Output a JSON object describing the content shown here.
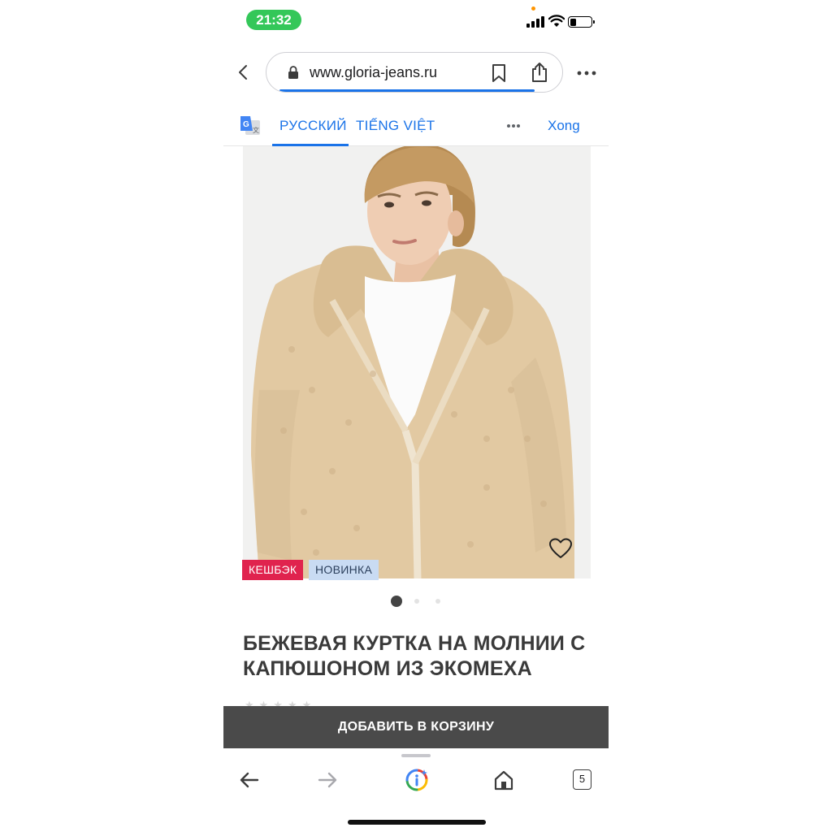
{
  "status_bar": {
    "time": "21:32",
    "tab_count": "5"
  },
  "browser": {
    "url": "www.gloria-jeans.ru"
  },
  "translate_bar": {
    "source_lang": "РУССКИЙ",
    "target_lang": "TIẾNG VIỆT",
    "done_label": "Xong"
  },
  "product": {
    "badges": [
      "КЕШБЭК",
      "НОВИНКА"
    ],
    "title": "БЕЖЕВАЯ КУРТКА НА МОЛНИИ С КАПЮШОНОМ ИЗ ЭКОМЕХА",
    "rating_stars": "★★★★★",
    "image_count": 3,
    "current_image": 1,
    "add_to_cart_label": "ДОБАВИТЬ В КОРЗИНУ"
  },
  "colors": {
    "accent": "#1a73e8",
    "cashback_badge": "#e0234e",
    "new_badge": "#c9dbf3",
    "cart_button": "#4a4a4a",
    "status_time": "#34c759"
  },
  "icons": [
    "back-chevron-icon",
    "lock-icon",
    "bookmark-icon",
    "share-icon",
    "more-icon",
    "google-translate-icon",
    "heart-icon",
    "back-arrow-icon",
    "forward-arrow-icon",
    "google-lens-icon",
    "home-icon",
    "tabs-icon"
  ]
}
